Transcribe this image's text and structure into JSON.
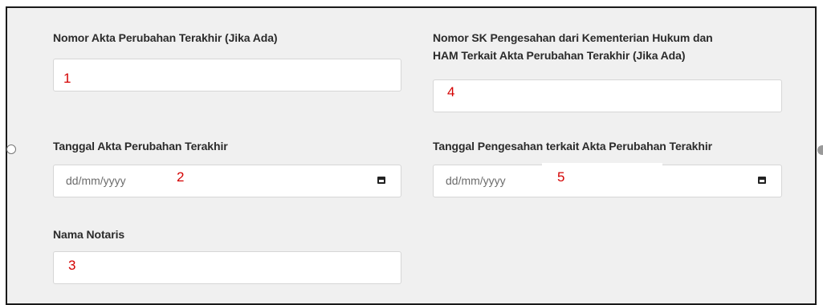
{
  "form": {
    "akta_perubahan": {
      "label": "Nomor Akta Perubahan Terakhir (Jika Ada)",
      "value": "",
      "annotation": "1"
    },
    "tanggal_akta": {
      "label": "Tanggal Akta Perubahan Terakhir",
      "placeholder": "dd/mm/yyyy",
      "annotation": "2"
    },
    "nama_notaris": {
      "label": "Nama Notaris",
      "value": "",
      "annotation": "3"
    },
    "nomor_sk": {
      "label_line1": "Nomor SK Pengesahan dari Kementerian Hukum dan",
      "label_line2": "HAM Terkait Akta Perubahan Terakhir (Jika Ada)",
      "value": "",
      "annotation": "4"
    },
    "tanggal_pengesahan": {
      "label": "Tanggal Pengesahan terkait Akta Perubahan Terakhir",
      "placeholder": "dd/mm/yyyy",
      "annotation": "5"
    }
  },
  "colors": {
    "panel_bg": "#f0f0f0",
    "annotation": "#d40000",
    "border": "#1a1a1a"
  }
}
